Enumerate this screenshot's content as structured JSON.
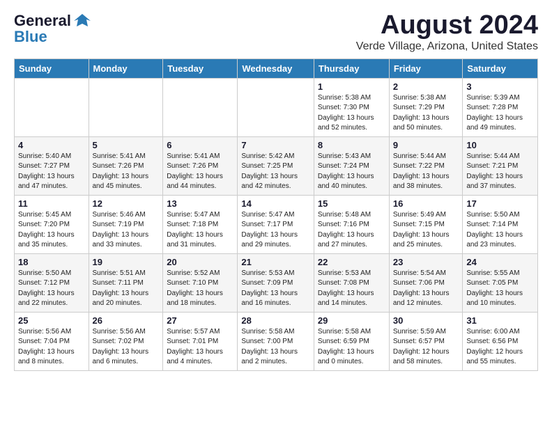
{
  "logo": {
    "line1": "General",
    "line2": "Blue"
  },
  "title": "August 2024",
  "subtitle": "Verde Village, Arizona, United States",
  "days_of_week": [
    "Sunday",
    "Monday",
    "Tuesday",
    "Wednesday",
    "Thursday",
    "Friday",
    "Saturday"
  ],
  "weeks": [
    [
      {
        "day": "",
        "info": ""
      },
      {
        "day": "",
        "info": ""
      },
      {
        "day": "",
        "info": ""
      },
      {
        "day": "",
        "info": ""
      },
      {
        "day": "1",
        "info": "Sunrise: 5:38 AM\nSunset: 7:30 PM\nDaylight: 13 hours\nand 52 minutes."
      },
      {
        "day": "2",
        "info": "Sunrise: 5:38 AM\nSunset: 7:29 PM\nDaylight: 13 hours\nand 50 minutes."
      },
      {
        "day": "3",
        "info": "Sunrise: 5:39 AM\nSunset: 7:28 PM\nDaylight: 13 hours\nand 49 minutes."
      }
    ],
    [
      {
        "day": "4",
        "info": "Sunrise: 5:40 AM\nSunset: 7:27 PM\nDaylight: 13 hours\nand 47 minutes."
      },
      {
        "day": "5",
        "info": "Sunrise: 5:41 AM\nSunset: 7:26 PM\nDaylight: 13 hours\nand 45 minutes."
      },
      {
        "day": "6",
        "info": "Sunrise: 5:41 AM\nSunset: 7:26 PM\nDaylight: 13 hours\nand 44 minutes."
      },
      {
        "day": "7",
        "info": "Sunrise: 5:42 AM\nSunset: 7:25 PM\nDaylight: 13 hours\nand 42 minutes."
      },
      {
        "day": "8",
        "info": "Sunrise: 5:43 AM\nSunset: 7:24 PM\nDaylight: 13 hours\nand 40 minutes."
      },
      {
        "day": "9",
        "info": "Sunrise: 5:44 AM\nSunset: 7:22 PM\nDaylight: 13 hours\nand 38 minutes."
      },
      {
        "day": "10",
        "info": "Sunrise: 5:44 AM\nSunset: 7:21 PM\nDaylight: 13 hours\nand 37 minutes."
      }
    ],
    [
      {
        "day": "11",
        "info": "Sunrise: 5:45 AM\nSunset: 7:20 PM\nDaylight: 13 hours\nand 35 minutes."
      },
      {
        "day": "12",
        "info": "Sunrise: 5:46 AM\nSunset: 7:19 PM\nDaylight: 13 hours\nand 33 minutes."
      },
      {
        "day": "13",
        "info": "Sunrise: 5:47 AM\nSunset: 7:18 PM\nDaylight: 13 hours\nand 31 minutes."
      },
      {
        "day": "14",
        "info": "Sunrise: 5:47 AM\nSunset: 7:17 PM\nDaylight: 13 hours\nand 29 minutes."
      },
      {
        "day": "15",
        "info": "Sunrise: 5:48 AM\nSunset: 7:16 PM\nDaylight: 13 hours\nand 27 minutes."
      },
      {
        "day": "16",
        "info": "Sunrise: 5:49 AM\nSunset: 7:15 PM\nDaylight: 13 hours\nand 25 minutes."
      },
      {
        "day": "17",
        "info": "Sunrise: 5:50 AM\nSunset: 7:14 PM\nDaylight: 13 hours\nand 23 minutes."
      }
    ],
    [
      {
        "day": "18",
        "info": "Sunrise: 5:50 AM\nSunset: 7:12 PM\nDaylight: 13 hours\nand 22 minutes."
      },
      {
        "day": "19",
        "info": "Sunrise: 5:51 AM\nSunset: 7:11 PM\nDaylight: 13 hours\nand 20 minutes."
      },
      {
        "day": "20",
        "info": "Sunrise: 5:52 AM\nSunset: 7:10 PM\nDaylight: 13 hours\nand 18 minutes."
      },
      {
        "day": "21",
        "info": "Sunrise: 5:53 AM\nSunset: 7:09 PM\nDaylight: 13 hours\nand 16 minutes."
      },
      {
        "day": "22",
        "info": "Sunrise: 5:53 AM\nSunset: 7:08 PM\nDaylight: 13 hours\nand 14 minutes."
      },
      {
        "day": "23",
        "info": "Sunrise: 5:54 AM\nSunset: 7:06 PM\nDaylight: 13 hours\nand 12 minutes."
      },
      {
        "day": "24",
        "info": "Sunrise: 5:55 AM\nSunset: 7:05 PM\nDaylight: 13 hours\nand 10 minutes."
      }
    ],
    [
      {
        "day": "25",
        "info": "Sunrise: 5:56 AM\nSunset: 7:04 PM\nDaylight: 13 hours\nand 8 minutes."
      },
      {
        "day": "26",
        "info": "Sunrise: 5:56 AM\nSunset: 7:02 PM\nDaylight: 13 hours\nand 6 minutes."
      },
      {
        "day": "27",
        "info": "Sunrise: 5:57 AM\nSunset: 7:01 PM\nDaylight: 13 hours\nand 4 minutes."
      },
      {
        "day": "28",
        "info": "Sunrise: 5:58 AM\nSunset: 7:00 PM\nDaylight: 13 hours\nand 2 minutes."
      },
      {
        "day": "29",
        "info": "Sunrise: 5:58 AM\nSunset: 6:59 PM\nDaylight: 13 hours\nand 0 minutes."
      },
      {
        "day": "30",
        "info": "Sunrise: 5:59 AM\nSunset: 6:57 PM\nDaylight: 12 hours\nand 58 minutes."
      },
      {
        "day": "31",
        "info": "Sunrise: 6:00 AM\nSunset: 6:56 PM\nDaylight: 12 hours\nand 55 minutes."
      }
    ]
  ]
}
